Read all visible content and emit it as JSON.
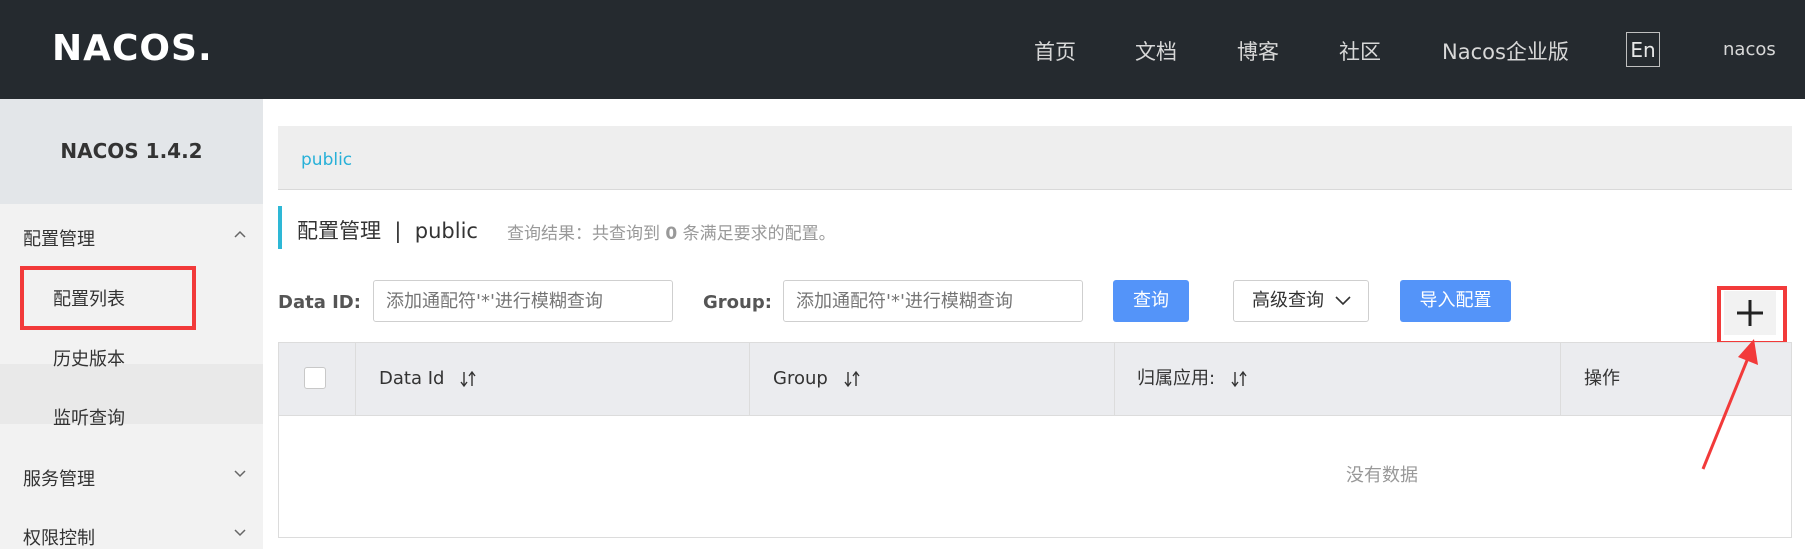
{
  "header": {
    "logo": "NACOS.",
    "nav": [
      "首页",
      "文档",
      "博客",
      "社区",
      "Nacos企业版"
    ],
    "lang_button": "En",
    "username": "nacos"
  },
  "sidebar": {
    "version": "NACOS 1.4.2",
    "groups": [
      {
        "label": "配置管理",
        "expanded": true,
        "items": [
          "配置列表",
          "历史版本",
          "监听查询"
        ]
      },
      {
        "label": "服务管理",
        "expanded": false
      },
      {
        "label": "权限控制",
        "expanded": false
      }
    ]
  },
  "namespace": {
    "current": "public"
  },
  "title": {
    "section": "配置管理",
    "separator": "|",
    "namespace": "public",
    "result_prefix": "查询结果：共查询到",
    "result_count": "0",
    "result_suffix": "条满足要求的配置。"
  },
  "filters": {
    "data_id_label": "Data ID:",
    "data_id_placeholder": "添加通配符'*'进行模糊查询",
    "group_label": "Group:",
    "group_placeholder": "添加通配符'*'进行模糊查询",
    "search_button": "查询",
    "advanced_button": "高级查询",
    "import_button": "导入配置"
  },
  "table": {
    "columns": [
      "Data Id",
      "Group",
      "归属应用:",
      "操作"
    ],
    "empty_text": "没有数据"
  },
  "colors": {
    "topbar": "#252a2f",
    "primary": "#5494f9",
    "accent": "#2eb8d6",
    "annotation": "#f23a3a"
  }
}
